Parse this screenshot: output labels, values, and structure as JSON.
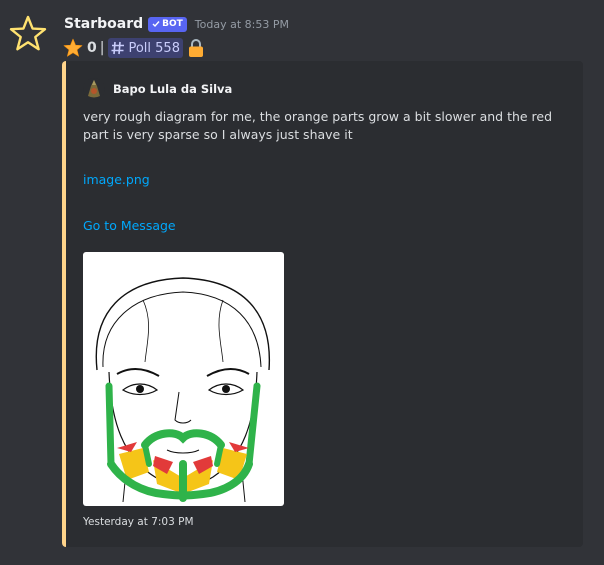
{
  "message": {
    "username": "Starboard",
    "bot_tag": "BOT",
    "timestamp": "Today at 8:53 PM",
    "star_count": "0",
    "separator": "|",
    "channel_mention": "Poll 558"
  },
  "embed": {
    "accent_color": "#ffd48b",
    "author_name": "Bapo Lula da Silva",
    "description": "very rough diagram for me, the orange parts grow a bit slower and the red part is very sparse so I always just shave it",
    "attachment_link": "image.png",
    "jump_link": "Go to Message",
    "footer_timestamp": "Yesterday at 7:03 PM"
  },
  "colors": {
    "background": "#313338",
    "embed_background": "#2b2d31",
    "link": "#00a8fc",
    "bot_tag": "#5865f2",
    "beard_green": "#2fb34a",
    "beard_orange": "#f5c518",
    "beard_red": "#e23a3a"
  }
}
